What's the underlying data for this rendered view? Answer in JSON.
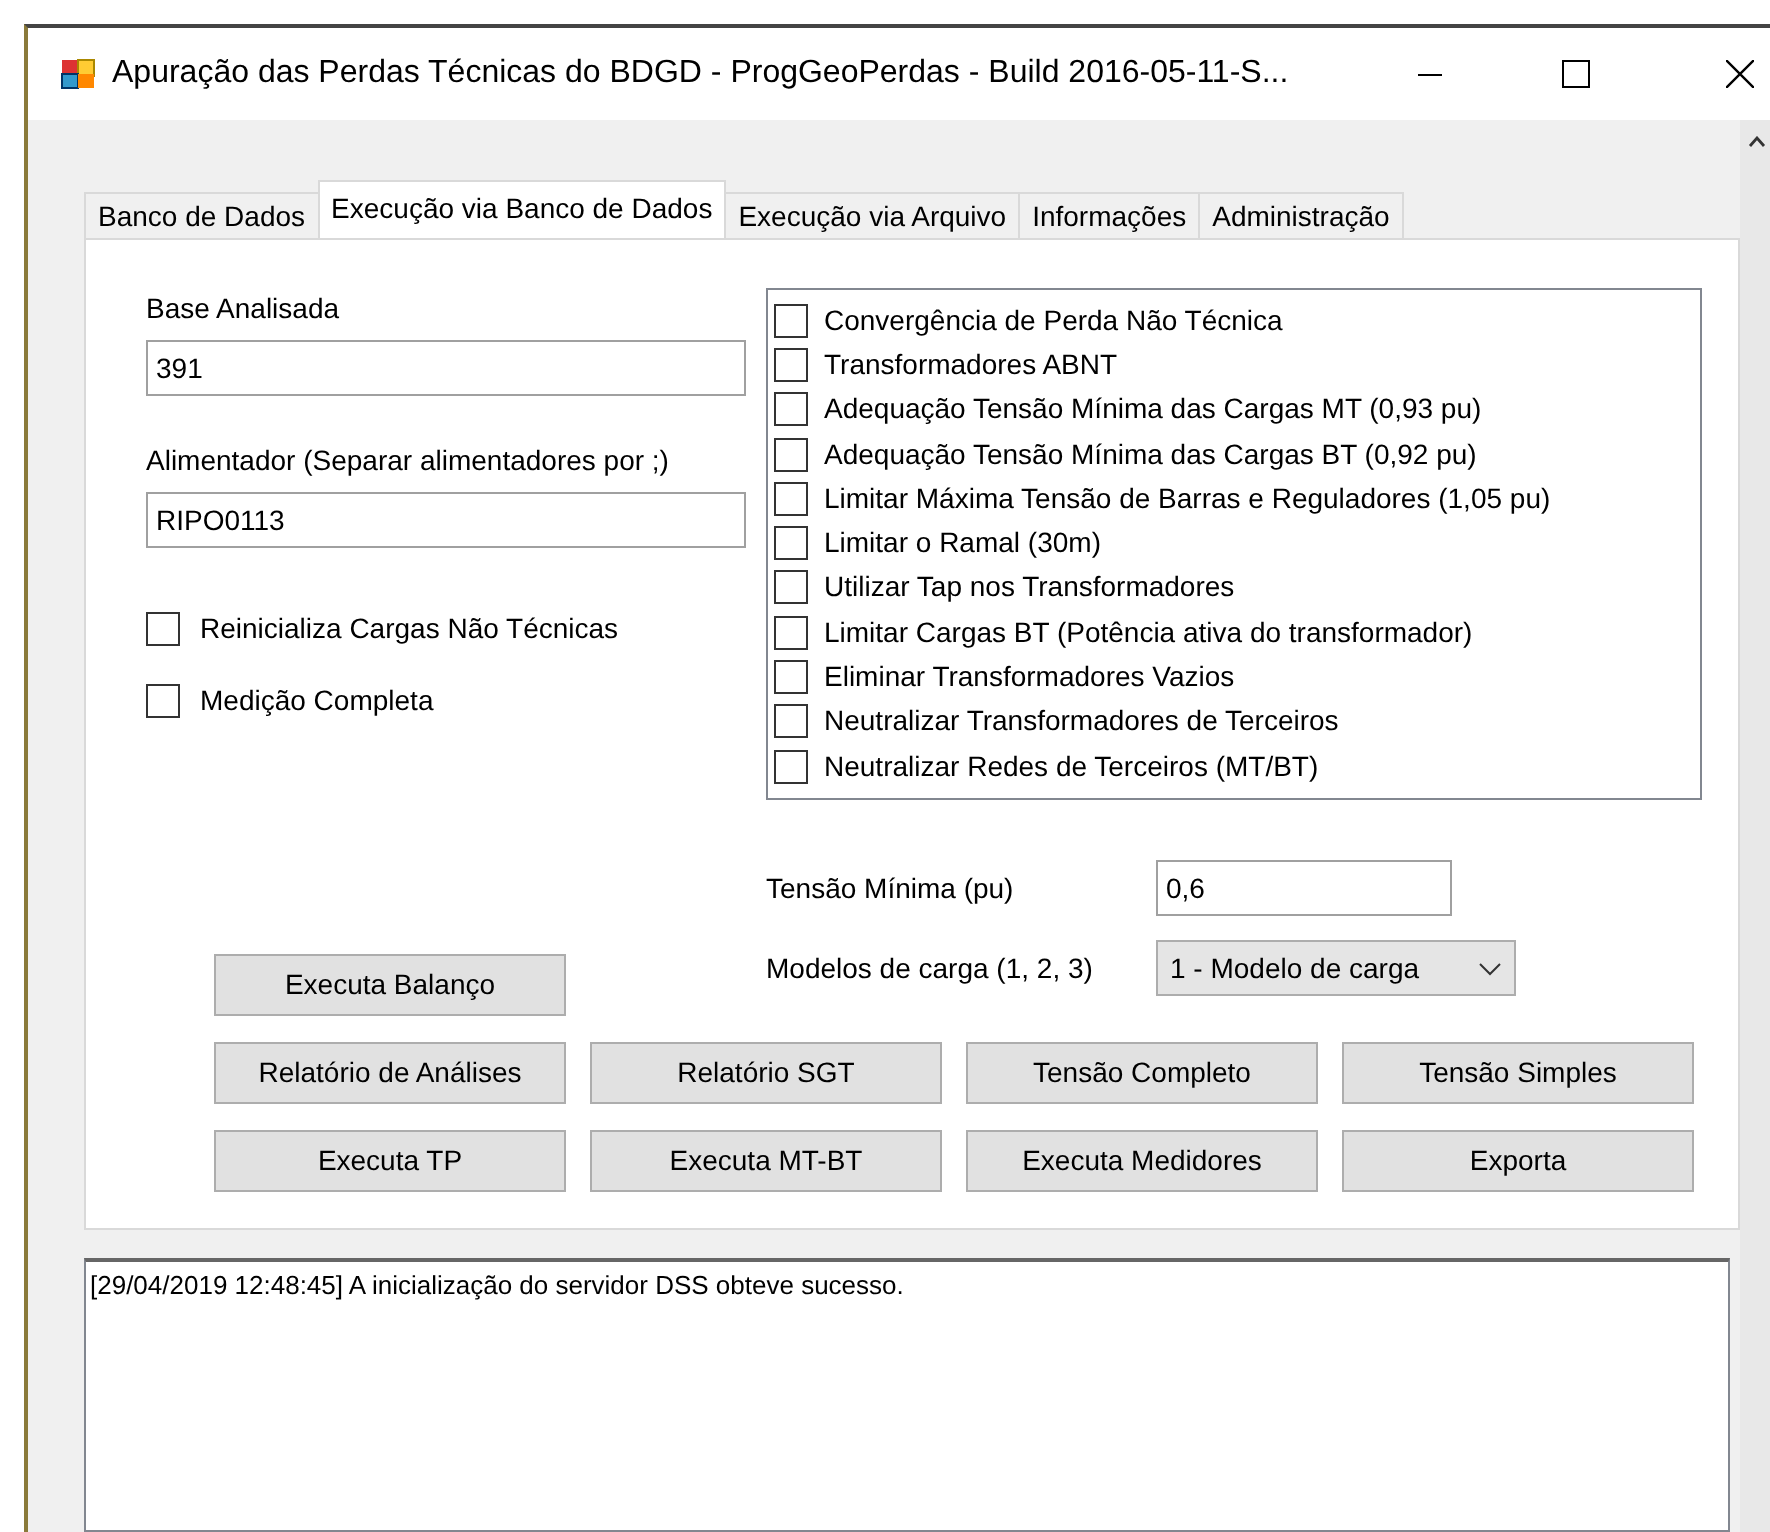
{
  "window": {
    "title": "Apuração das Perdas Técnicas do BDGD - ProgGeoPerdas - Build 2016-05-11-S..."
  },
  "tabs": [
    {
      "label": "Banco de Dados",
      "selected": false
    },
    {
      "label": "Execução via Banco de Dados",
      "selected": true
    },
    {
      "label": "Execução via Arquivo",
      "selected": false
    },
    {
      "label": "Informações",
      "selected": false
    },
    {
      "label": "Administração",
      "selected": false
    }
  ],
  "base_analisada": {
    "label": "Base Analisada",
    "value": "391"
  },
  "alimentador": {
    "label": "Alimentador (Separar alimentadores por ;)",
    "value": "RIPO0113"
  },
  "options": [
    {
      "label": "Reinicializa Cargas Não Técnicas",
      "checked": false
    },
    {
      "label": "Medição Completa",
      "checked": false
    }
  ],
  "checklist": [
    {
      "label": "Convergência de Perda Não Técnica",
      "checked": false
    },
    {
      "label": "Transformadores ABNT",
      "checked": false
    },
    {
      "label": "Adequação Tensão Mínima das Cargas MT (0,93 pu)",
      "checked": false
    },
    {
      "label": "Adequação Tensão Mínima das Cargas BT (0,92 pu)",
      "checked": false
    },
    {
      "label": "Limitar Máxima Tensão de Barras e Reguladores (1,05 pu)",
      "checked": false
    },
    {
      "label": "Limitar o Ramal (30m)",
      "checked": false
    },
    {
      "label": "Utilizar Tap nos Transformadores",
      "checked": false
    },
    {
      "label": "Limitar Cargas BT (Potência ativa do transformador)",
      "checked": false
    },
    {
      "label": "Eliminar Transformadores Vazios",
      "checked": false
    },
    {
      "label": "Neutralizar Transformadores de Terceiros",
      "checked": false
    },
    {
      "label": "Neutralizar Redes de Terceiros (MT/BT)",
      "checked": false
    }
  ],
  "tensao_minima": {
    "label": "Tensão Mínima (pu)",
    "value": "0,6"
  },
  "modelos_carga": {
    "label": "Modelos de carga (1, 2, 3)",
    "value": "1 - Modelo de carga"
  },
  "balanco_button": "Executa Balanço",
  "button_rows": [
    [
      "Relatório de Análises",
      "Relatório SGT",
      "Tensão Completo",
      "Tensão Simples"
    ],
    [
      "Executa TP",
      "Executa MT-BT",
      "Executa Medidores",
      "Exporta"
    ]
  ],
  "log": {
    "lines": [
      "[29/04/2019 12:48:45] A inicialização do servidor DSS obteve sucesso."
    ]
  }
}
